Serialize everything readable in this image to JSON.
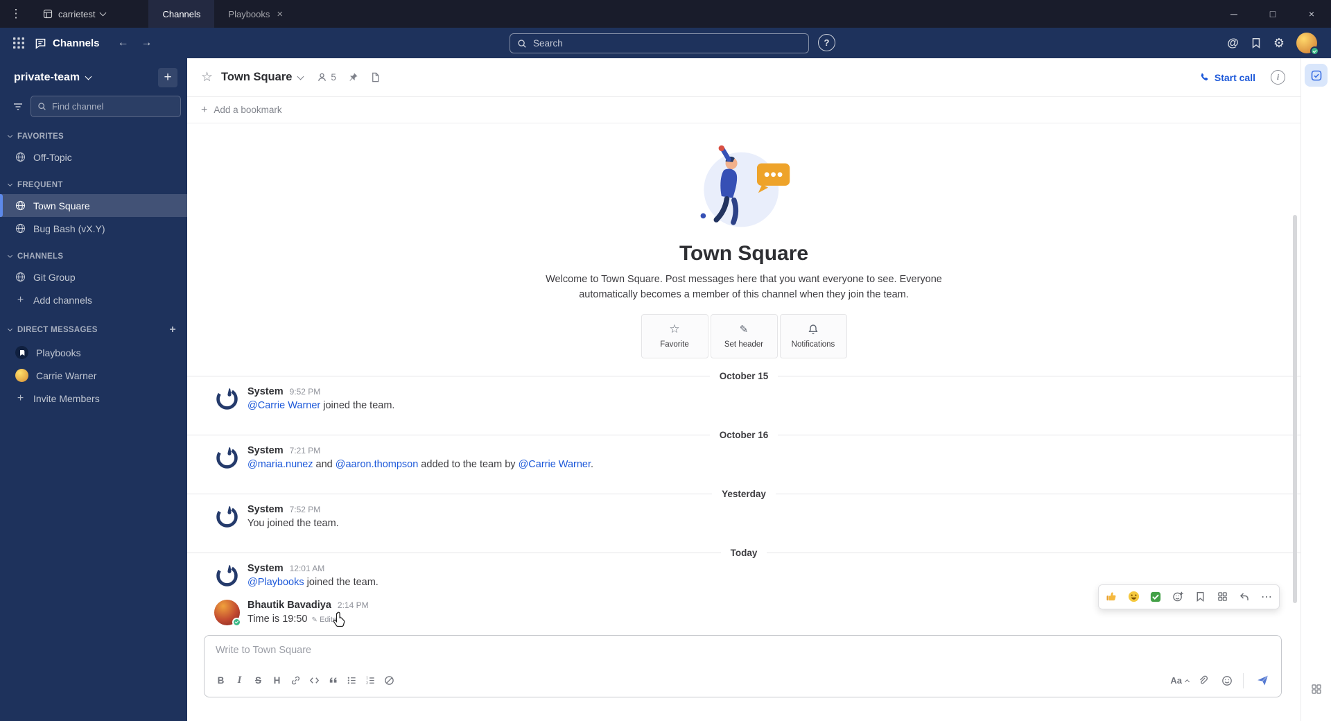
{
  "icons": {
    "menu": "⋮",
    "tab_close": "×",
    "win_min": "─",
    "win_max": "□",
    "win_close": "×",
    "back": "←",
    "forward": "→",
    "at_mention": "@",
    "gear": "⚙",
    "help": "?",
    "plus": "+",
    "star": "☆",
    "info": "i",
    "more": "⋯",
    "bold": "B",
    "italic": "I",
    "strike": "S",
    "heading": "H",
    "font": "Aa",
    "pencil": "✎"
  },
  "titlebar": {
    "server_name": "carrietest",
    "tabs": [
      {
        "label": "Channels"
      },
      {
        "label": "Playbooks"
      }
    ]
  },
  "global_header": {
    "product_label": "Channels",
    "search_placeholder": "Search"
  },
  "sidebar": {
    "team_name": "private-team",
    "find_placeholder": "Find channel",
    "sections": [
      {
        "label": "FAVORITES",
        "items": [
          {
            "name": "Off-Topic"
          }
        ]
      },
      {
        "label": "FREQUENT",
        "items": [
          {
            "name": "Town Square"
          },
          {
            "name": "Bug Bash (vX.Y)"
          }
        ]
      },
      {
        "label": "CHANNELS",
        "items": [
          {
            "name": "Git Group"
          },
          {
            "name": "Add channels"
          }
        ]
      },
      {
        "label": "DIRECT MESSAGES",
        "items": [
          {
            "name": "Playbooks"
          },
          {
            "name": "Carrie Warner"
          },
          {
            "name": "Invite Members"
          }
        ]
      }
    ]
  },
  "channel_header": {
    "title": "Town Square",
    "member_count": "5",
    "start_call_label": "Start call"
  },
  "bookmark_bar": {
    "add_label": "Add a bookmark"
  },
  "intro": {
    "title": "Town Square",
    "description": "Welcome to Town Square. Post messages here that you want everyone to see. Everyone automatically becomes a member of this channel when they join the team.",
    "actions": [
      {
        "label": "Favorite"
      },
      {
        "label": "Set header"
      },
      {
        "label": "Notifications"
      }
    ]
  },
  "messages": [
    {
      "divider": "October 15"
    },
    {
      "sender": "System",
      "time": "9:52 PM",
      "segments": [
        {
          "text": "@Carrie Warner",
          "mention": true
        },
        {
          "text": " joined the team."
        }
      ]
    },
    {
      "divider": "October 16"
    },
    {
      "sender": "System",
      "time": "7:21 PM",
      "segments": [
        {
          "text": "@maria.nunez",
          "mention": true
        },
        {
          "text": " and "
        },
        {
          "text": "@aaron.thompson",
          "mention": true
        },
        {
          "text": " added to the team by "
        },
        {
          "text": "@Carrie Warner",
          "mention": true
        },
        {
          "text": "."
        }
      ]
    },
    {
      "divider": "Yesterday"
    },
    {
      "sender": "System",
      "time": "7:52 PM",
      "segments": [
        {
          "text": "You joined the team."
        }
      ]
    },
    {
      "divider": "Today"
    },
    {
      "sender": "System",
      "time": "12:01 AM",
      "segments": [
        {
          "text": "@Playbooks",
          "mention": true
        },
        {
          "text": " joined the team."
        }
      ]
    },
    {
      "sender": "Bhautik Bavadiya",
      "time": "2:14 PM",
      "segments": [
        {
          "text": "Time is 19:50"
        }
      ],
      "edited_label": "Edited"
    }
  ],
  "message_actions": {
    "reactions": [
      "thumbsup",
      "smile",
      "white_check_mark"
    ]
  },
  "composer": {
    "placeholder": "Write to Town Square"
  },
  "colors": {
    "navy": "#1e325c",
    "link_blue": "#1c58d9",
    "selected_indicator": "#5d89ea",
    "online_green": "#3db887"
  }
}
